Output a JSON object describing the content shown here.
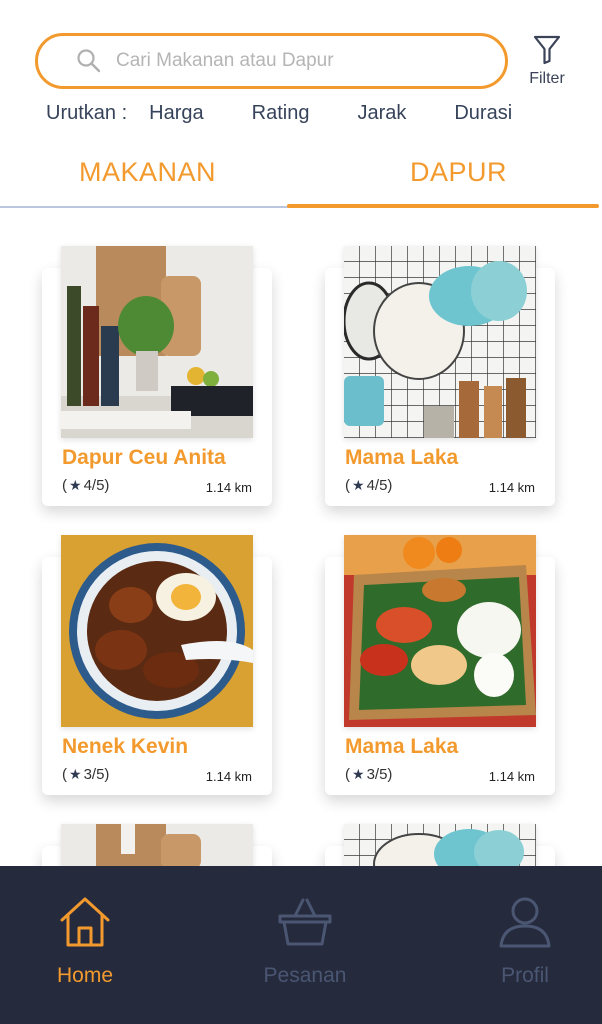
{
  "search": {
    "placeholder": "Cari Makanan atau Dapur"
  },
  "filter": {
    "label": "Filter"
  },
  "sort": {
    "label": "Urutkan :",
    "options": [
      "Harga",
      "Rating",
      "Jarak",
      "Durasi"
    ]
  },
  "tabs": [
    {
      "label": "MAKANAN",
      "active": false
    },
    {
      "label": "DAPUR",
      "active": true
    }
  ],
  "kitchens": [
    {
      "name": "Dapur Ceu Anita",
      "rating_open": "(",
      "rating": "4/5",
      "rating_close": ")",
      "distance": "1.14 km",
      "image": "kitchen-shelf-photo"
    },
    {
      "name": "Mama Laka",
      "rating_open": "(",
      "rating": "4/5",
      "rating_close": ")",
      "distance": "1.14 km",
      "image": "colander-wall-photo"
    },
    {
      "name": "Nenek Kevin",
      "rating_open": "(",
      "rating": "3/5",
      "rating_close": ")",
      "distance": "1.14 km",
      "image": "stew-bowl-photo"
    },
    {
      "name": "Mama Laka",
      "rating_open": "(",
      "rating": "3/5",
      "rating_close": ")",
      "distance": "1.14 km",
      "image": "rice-basket-photo"
    }
  ],
  "bottom_nav": [
    {
      "label": "Home",
      "icon": "home-icon",
      "active": true
    },
    {
      "label": "Pesanan",
      "icon": "basket-icon",
      "active": false
    },
    {
      "label": "Profil",
      "icon": "user-icon",
      "active": false
    }
  ],
  "colors": {
    "accent": "#F39A2E",
    "nav_bg": "#252b3d",
    "text": "#36435a",
    "inactive": "#4a5672"
  }
}
